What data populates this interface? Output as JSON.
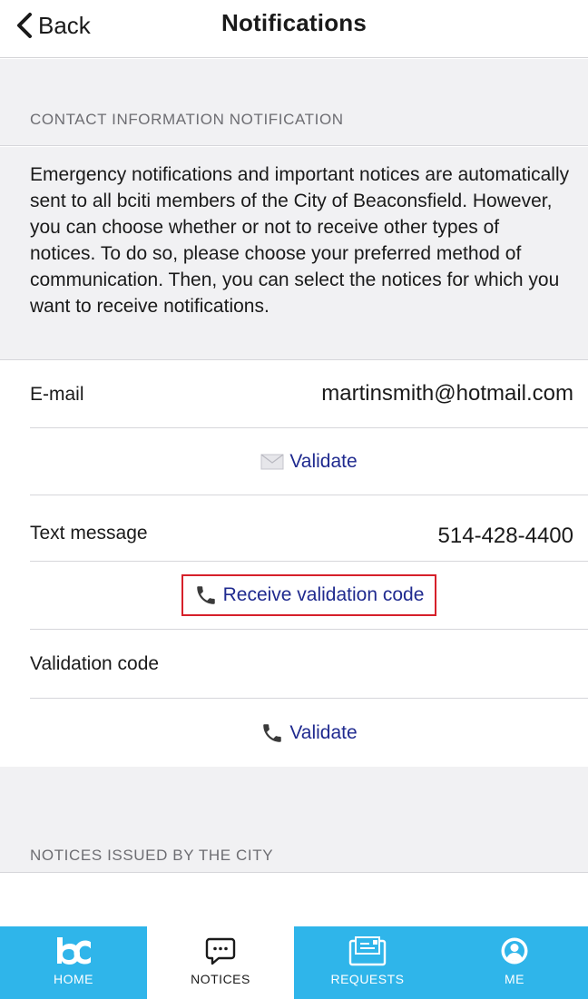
{
  "header": {
    "back_label": "Back",
    "title": "Notifications"
  },
  "contact_section": {
    "header": "CONTACT INFORMATION NOTIFICATION",
    "description": "Emergency notifications and important notices are automatically sent to all bciti members of the City of Beaconsfield. However, you can choose whether or not to receive other types of notices. To do so, please choose your preferred method of communication. Then, you can select the notices for which you want to receive notifications."
  },
  "email": {
    "label": "E-mail",
    "value": "martinsmith@hotmail.com",
    "validate_label": "Validate",
    "validate_icon": "envelope-icon"
  },
  "text_message": {
    "label": "Text message",
    "value": "514-428-4400",
    "receive_code_label": "Receive validation code",
    "receive_code_icon": "phone-icon"
  },
  "validation_code": {
    "label": "Validation code",
    "value": "",
    "validate_label": "Validate",
    "validate_icon": "phone-icon"
  },
  "notices_section": {
    "header": "NOTICES ISSUED BY THE CITY"
  },
  "tabbar": {
    "tabs": [
      {
        "label": "HOME",
        "icon": "bc-logo-icon",
        "active": false
      },
      {
        "label": "NOTICES",
        "icon": "chat-bubble-icon",
        "active": true
      },
      {
        "label": "REQUESTS",
        "icon": "document-tray-icon",
        "active": false
      },
      {
        "label": "ME",
        "icon": "user-circle-icon",
        "active": false
      }
    ]
  },
  "colors": {
    "link": "#1f2a8f",
    "tab_bar": "#2fb5ea",
    "section_background": "#f1f1f3",
    "highlight_border": "#d6202a"
  }
}
